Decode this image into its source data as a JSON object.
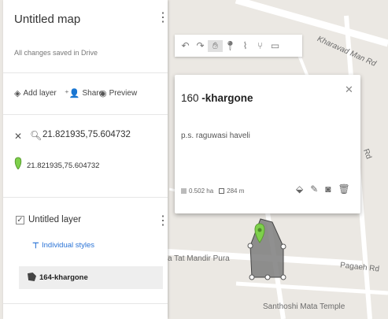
{
  "sidebar": {
    "title": "Untitled map",
    "saved_status": "All changes saved in Drive",
    "actions": {
      "add_layer": "Add layer",
      "share": "Share",
      "preview": "Preview"
    },
    "search": {
      "query": "21.821935,75.604732",
      "result": "21.821935,75.604732"
    },
    "layer": {
      "name": "Untitled layer",
      "styles_link": "Individual styles",
      "feature": "164-khargone"
    }
  },
  "toolbar": {
    "tools": [
      "undo-icon",
      "redo-icon",
      "hand-icon",
      "marker-icon",
      "draw-line-icon",
      "route-icon",
      "ruler-icon"
    ]
  },
  "popup": {
    "number": "160",
    "name": "-khargone",
    "description": "p.s. raguwasi haveli",
    "area": "0.502 ha",
    "perimeter": "284 m",
    "action_icons": [
      "paint-bucket-icon",
      "pencil-icon",
      "camera-icon",
      "trash-icon"
    ]
  },
  "map": {
    "labels": {
      "road_top": "Kharavad Man Rd",
      "road_right": "Rd",
      "temple_left": "a Tat Mandir Pura",
      "road_bottom_right": "Pagaeh Rd",
      "temple_bottom": "Santhoshi Mata Temple"
    }
  },
  "colors": {
    "accent_blue": "#2a73d6",
    "marker_green": "#7ed04b",
    "polygon_gray": "#7d7d7d"
  }
}
